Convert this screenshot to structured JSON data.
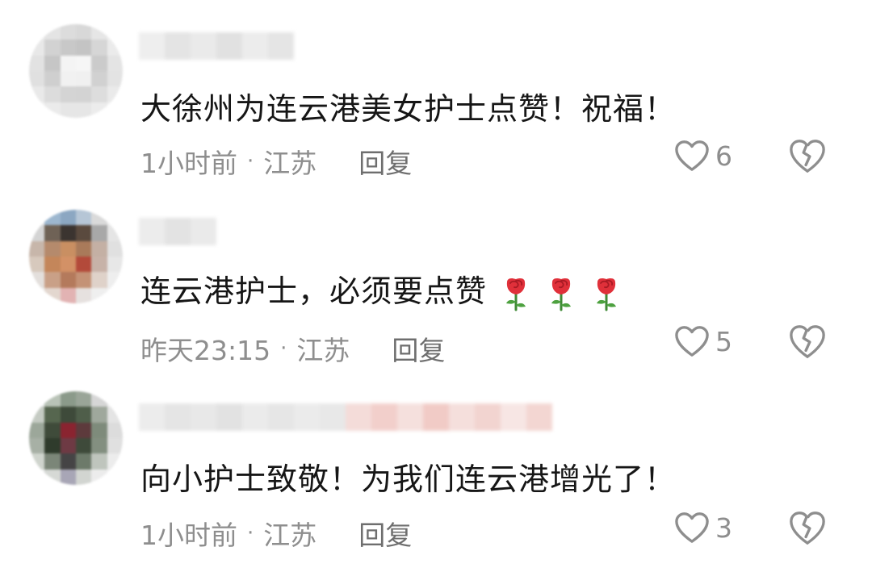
{
  "comments": [
    {
      "text": "大徐州为连云港美女护士点赞！祝福！",
      "time": "1小时前",
      "location": "江苏",
      "reply": "回复",
      "likes": "6",
      "roses": 0
    },
    {
      "text": "连云港护士，必须要点赞",
      "time": "昨天23:15",
      "location": "江苏",
      "reply": "回复",
      "likes": "5",
      "roses": 3
    },
    {
      "text": "向小护士致敬！为我们连云港增光了！",
      "time": "1小时前",
      "location": "江苏",
      "reply": "回复",
      "likes": "3",
      "roses": 0
    }
  ],
  "separator": "·",
  "icons": {
    "like": "heart-outline-icon",
    "dislike": "broken-heart-icon",
    "emoji": "rose-emoji-icon"
  },
  "colors": {
    "text": "#161616",
    "meta": "#8e8e8e",
    "icon": "#8e8e8e"
  }
}
